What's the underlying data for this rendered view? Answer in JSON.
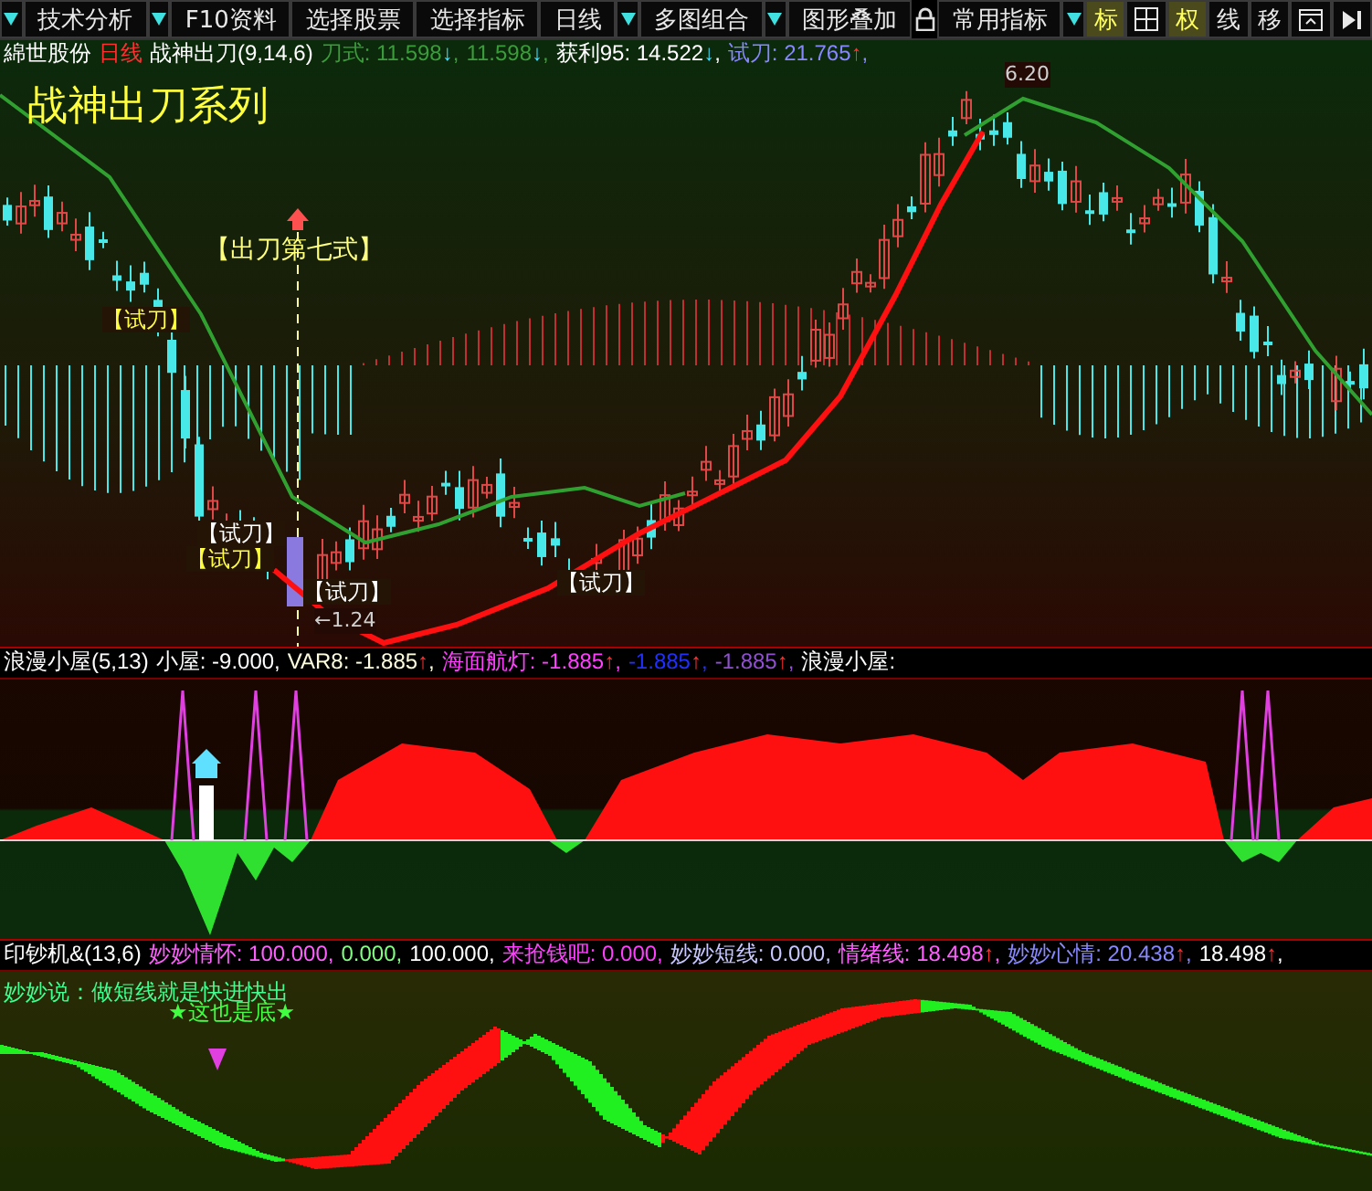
{
  "toolbar": {
    "items": [
      {
        "kind": "caret"
      },
      {
        "kind": "button",
        "label": "技术分析"
      },
      {
        "kind": "caret"
      },
      {
        "kind": "button",
        "label": "F10资料"
      },
      {
        "kind": "button",
        "label": "选择股票"
      },
      {
        "kind": "button",
        "label": "选择指标"
      },
      {
        "kind": "button",
        "label": "日线"
      },
      {
        "kind": "caret"
      },
      {
        "kind": "button",
        "label": "多图组合"
      },
      {
        "kind": "caret"
      },
      {
        "kind": "button",
        "label": "图形叠加"
      },
      {
        "kind": "lock"
      },
      {
        "kind": "button",
        "label": "常用指标"
      },
      {
        "kind": "caret"
      }
    ],
    "tools": [
      {
        "kind": "text",
        "label": "标",
        "selected": true
      },
      {
        "kind": "crosshair",
        "selected": false
      },
      {
        "kind": "text",
        "label": "权",
        "selected": true
      },
      {
        "kind": "text",
        "label": "线",
        "selected": false
      },
      {
        "kind": "text",
        "label": "移",
        "selected": false
      },
      {
        "kind": "window",
        "selected": false
      },
      {
        "kind": "end",
        "selected": false
      }
    ]
  },
  "panels": [
    {
      "kind": "price",
      "legend": [
        {
          "text": "綿世股份",
          "color": "#ffffff"
        },
        {
          "text": "日线",
          "color": "#ff3030"
        },
        {
          "text": "战神出刀(9,14,6)",
          "color": "#ffffff"
        },
        {
          "text": "刀式: 11.598",
          "color": "#3c9c3c",
          "arrow": "↓",
          "rising": false,
          "suffix": ","
        },
        {
          "text": "11.598",
          "color": "#3c9c3c",
          "arrow": "↓",
          "rising": false,
          "suffix": ","
        },
        {
          "text": "获利95: 14.522",
          "color": "#ffffff",
          "arrow": "↓",
          "rising": false,
          "suffix": ","
        },
        {
          "text": "试刀: 21.765",
          "color": "#8888ff",
          "arrow": "↑",
          "rising": true,
          "suffix": ","
        }
      ],
      "annotations": [
        {
          "kind": "title",
          "text": "战神出刀系列"
        },
        {
          "kind": "signal",
          "text": "【出刀第七式】"
        },
        {
          "kind": "tag",
          "text": "【试刀】"
        },
        {
          "kind": "mark",
          "text": "【试刀】"
        },
        {
          "kind": "tag",
          "text": "【试刀】"
        },
        {
          "kind": "mark",
          "text": "【试刀】"
        },
        {
          "kind": "mark",
          "text": "【试刀】"
        },
        {
          "kind": "value",
          "text": "←1.24"
        },
        {
          "kind": "value",
          "text": "6.20"
        }
      ]
    },
    {
      "kind": "oscillator",
      "legend": [
        {
          "text": "浪漫小屋(5,13)",
          "color": "#ffffff"
        },
        {
          "text": "小屋: -9.000,",
          "color": "#ffffff"
        },
        {
          "text": "VAR8: -1.885",
          "color": "#ffffe0",
          "arrow": "↑",
          "rising": true,
          "suffix": ","
        },
        {
          "text": "海面航灯: -1.885",
          "color": "#ff40ff",
          "arrow": "↑",
          "rising": true,
          "suffix": ","
        },
        {
          "text": "-1.885",
          "color": "#2030ff",
          "arrow": "↑",
          "rising": true,
          "suffix": ","
        },
        {
          "text": "-1.885",
          "color": "#9050d0",
          "arrow": "↑",
          "rising": true,
          "suffix": ","
        },
        {
          "text": "浪漫小屋:",
          "color": "#ffffff"
        }
      ]
    },
    {
      "kind": "wave",
      "legend": [
        {
          "text": "印钞机&(13,6)",
          "color": "#ffffff"
        },
        {
          "text": "妙妙情怀: 100.000,",
          "color": "#ff60ff"
        },
        {
          "text": "0.000,",
          "color": "#80ff80"
        },
        {
          "text": "100.000,",
          "color": "#ffffff"
        },
        {
          "text": "来抢钱吧: 0.000,",
          "color": "#ff40ff"
        },
        {
          "text": "妙妙短线: 0.000,",
          "color": "#c8c8ff"
        },
        {
          "text": "情绪线: 18.498",
          "color": "#ff60ff",
          "arrow": "↑",
          "rising": true,
          "suffix": ","
        },
        {
          "text": "妙妙心情: 20.438",
          "color": "#8888ff",
          "arrow": "↑",
          "rising": true,
          "suffix": ","
        },
        {
          "text": "18.498",
          "color": "#ffffff",
          "arrow": "↑",
          "rising": true,
          "suffix": ","
        }
      ],
      "note": "妙妙说：做短线就是快进快出",
      "annotations": [
        {
          "kind": "star",
          "text": "★这也是底★"
        }
      ]
    }
  ]
}
